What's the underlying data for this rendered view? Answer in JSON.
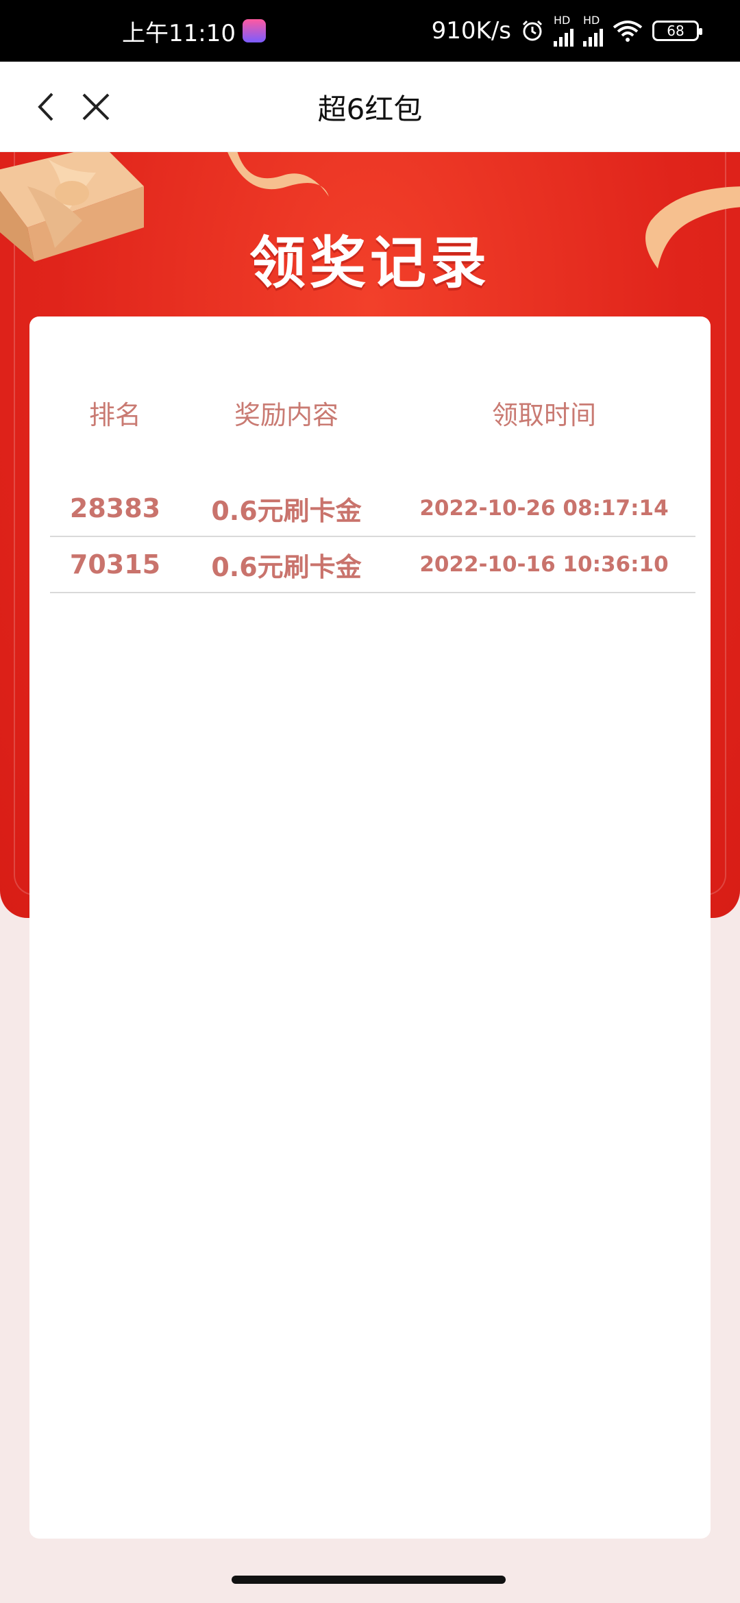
{
  "status_bar": {
    "time": "上午11:10",
    "network_speed": "910K/s",
    "hd_label": "HD",
    "battery": "68"
  },
  "nav": {
    "title": "超6红包",
    "back_icon": "chevron-left-icon",
    "close_icon": "close-icon"
  },
  "banner": {
    "title": "领奖记录"
  },
  "table": {
    "headers": [
      "排名",
      "奖励内容",
      "领取时间"
    ],
    "rows": [
      {
        "rank": "28383",
        "reward": "0.6元刷卡金",
        "time": "2022-10-26 08:17:14"
      },
      {
        "rank": "70315",
        "reward": "0.6元刷卡金",
        "time": "2022-10-16 10:36:10"
      }
    ]
  },
  "colors": {
    "banner_red": "#e0241b",
    "text_pink": "#c9736c",
    "page_bg": "#f6e9e8"
  }
}
